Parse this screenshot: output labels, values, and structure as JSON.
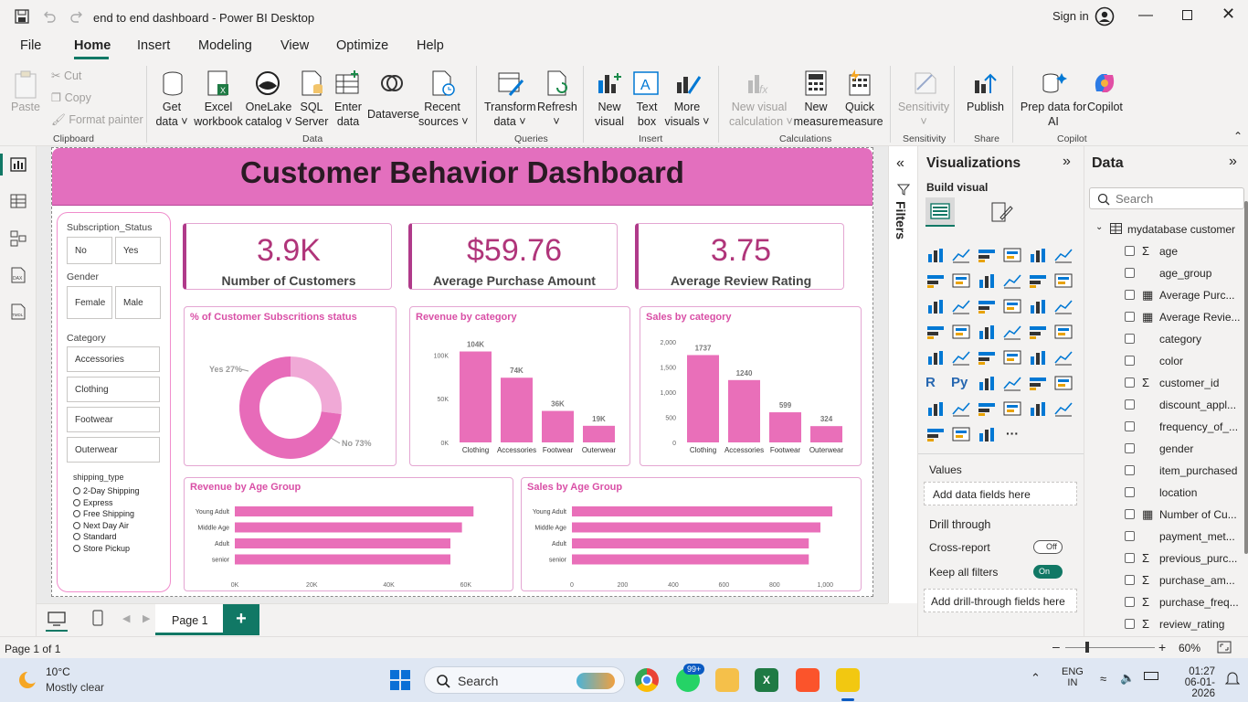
{
  "app": {
    "title": "end to end dashboard - Power BI Desktop",
    "sign_in": "Sign in"
  },
  "menu": [
    "File",
    "Home",
    "Insert",
    "Modeling",
    "View",
    "Optimize",
    "Help"
  ],
  "ribbon": {
    "clipboard": {
      "paste": "Paste",
      "cut": "Cut",
      "copy": "Copy",
      "format_painter": "Format painter",
      "group": "Clipboard"
    },
    "data": {
      "get_data": "Get\ndata ˅",
      "excel": "Excel\nworkbook",
      "onelake": "OneLake\ncatalog ˅",
      "sql": "SQL\nServer",
      "enter": "Enter\ndata",
      "dataverse": "Dataverse",
      "recent": "Recent\nsources ˅",
      "group": "Data"
    },
    "queries": {
      "transform": "Transform\ndata ˅",
      "refresh": "Refresh\n˅",
      "group": "Queries"
    },
    "insert": {
      "new_visual": "New\nvisual",
      "text_box": "Text\nbox",
      "more": "More\nvisuals ˅",
      "group": "Insert"
    },
    "calculations": {
      "new_visual_calc": "New visual\ncalculation ˅",
      "new_measure": "New\nmeasure",
      "quick_measure": "Quick\nmeasure",
      "group": "Calculations"
    },
    "sensitivity": {
      "label": "Sensitivity\n˅",
      "group": "Sensitivity"
    },
    "share": {
      "publish": "Publish",
      "group": "Share"
    },
    "copilot": {
      "prep": "Prep data for\nAI",
      "copilot": "Copilot",
      "group": "Copilot"
    }
  },
  "dashboard": {
    "title": "Customer Behavior  Dashboard",
    "kpis": [
      {
        "value": "3.9K",
        "label": "Number of Customers"
      },
      {
        "value": "$59.76",
        "label": "Average Purchase Amount"
      },
      {
        "value": "3.75",
        "label": "Average Review Rating"
      }
    ],
    "slicers": {
      "subscription_title": "Subscription_Status",
      "subscription": [
        "No",
        "Yes"
      ],
      "gender_title": "Gender",
      "gender": [
        "Female",
        "Male"
      ],
      "category_title": "Category",
      "category": [
        "Accessories",
        "Clothing",
        "Footwear",
        "Outerwear"
      ],
      "shipping_title": "shipping_type",
      "shipping": [
        "2-Day Shipping",
        "Express",
        "Free Shipping",
        "Next Day Air",
        "Standard",
        "Store Pickup"
      ]
    },
    "charts": {
      "donut_title": "% of Customer Subscritions status",
      "rev_cat_title": "Revenue by category",
      "sales_cat_title": "Sales by category",
      "rev_age_title": "Revenue by Age Group",
      "sales_age_title": "Sales by Age Group"
    }
  },
  "chart_data": [
    {
      "type": "pie",
      "title": "% of Customer Subscritions status",
      "categories": [
        "Yes",
        "No"
      ],
      "values": [
        27,
        73
      ],
      "data_labels": [
        "Yes 27%",
        "No 73%"
      ]
    },
    {
      "type": "bar",
      "title": "Revenue by category",
      "categories": [
        "Clothing",
        "Accessories",
        "Footwear",
        "Outerwear"
      ],
      "values": [
        104000,
        74000,
        36000,
        19000
      ],
      "data_labels": [
        "104K",
        "74K",
        "36K",
        "19K"
      ],
      "yticks": [
        "0K",
        "50K",
        "100K"
      ],
      "ylim": [
        0,
        115000
      ]
    },
    {
      "type": "bar",
      "title": "Sales by category",
      "categories": [
        "Clothing",
        "Accessories",
        "Footwear",
        "Outerwear"
      ],
      "values": [
        1737,
        1240,
        599,
        324
      ],
      "data_labels": [
        "1737",
        "1240",
        "599",
        "324"
      ],
      "yticks": [
        "0",
        "500",
        "1,000",
        "1,500",
        "2,000"
      ],
      "ylim": [
        0,
        2000
      ]
    },
    {
      "type": "bar",
      "orientation": "horizontal",
      "title": "Revenue by Age Group",
      "categories": [
        "Young Adult",
        "Middle Age",
        "Adult",
        "senior"
      ],
      "values": [
        62000,
        59000,
        56000,
        56000
      ],
      "xticks": [
        "0K",
        "20K",
        "40K",
        "60K"
      ],
      "xlim": [
        0,
        70000
      ]
    },
    {
      "type": "bar",
      "orientation": "horizontal",
      "title": "Sales by Age Group",
      "categories": [
        "Young Adult",
        "Middle Age",
        "Adult",
        "senior"
      ],
      "values": [
        1028,
        981,
        935,
        935
      ],
      "xticks": [
        "0",
        "200",
        "400",
        "600",
        "800",
        "1,000"
      ],
      "xlim": [
        0,
        1100
      ]
    }
  ],
  "filters_label": "Filters",
  "viz_pane": {
    "title": "Visualizations",
    "build": "Build visual",
    "values": "Values",
    "add_data": "Add data fields here",
    "drill": "Drill through",
    "cross": "Cross-report",
    "cross_state": "Off",
    "keep": "Keep all filters",
    "keep_state": "On",
    "add_drill": "Add drill-through fields here"
  },
  "data_pane": {
    "title": "Data",
    "search_placeholder": "Search",
    "table": "mydatabase customer",
    "fields": [
      {
        "name": "age",
        "kind": "sigma"
      },
      {
        "name": "age_group",
        "kind": ""
      },
      {
        "name": "Average Purc...",
        "kind": "calc"
      },
      {
        "name": "Average Revie...",
        "kind": "calc"
      },
      {
        "name": "category",
        "kind": ""
      },
      {
        "name": "color",
        "kind": ""
      },
      {
        "name": "customer_id",
        "kind": "sigma"
      },
      {
        "name": "discount_appl...",
        "kind": ""
      },
      {
        "name": "frequency_of_...",
        "kind": ""
      },
      {
        "name": "gender",
        "kind": ""
      },
      {
        "name": "item_purchased",
        "kind": ""
      },
      {
        "name": "location",
        "kind": ""
      },
      {
        "name": "Number of Cu...",
        "kind": "calc"
      },
      {
        "name": "payment_met...",
        "kind": ""
      },
      {
        "name": "previous_purc...",
        "kind": "sigma"
      },
      {
        "name": "purchase_am...",
        "kind": "sigma"
      },
      {
        "name": "purchase_freq...",
        "kind": "sigma"
      },
      {
        "name": "review_rating",
        "kind": "sigma"
      }
    ]
  },
  "pages": {
    "page1": "Page 1",
    "add": "+"
  },
  "status": {
    "page": "Page 1 of 1",
    "zoom": "60%"
  },
  "taskbar": {
    "temp": "10°C",
    "weather": "Mostly clear",
    "search": "Search",
    "badge": "99+",
    "lang1": "ENG",
    "lang2": "IN",
    "time": "01:27",
    "date": "06-01-2026"
  },
  "colors": {
    "accent": "#e57fc0",
    "bar": "#e96fb9",
    "title_bg": "#e36fbe",
    "kpi_text": "#b0357a"
  }
}
